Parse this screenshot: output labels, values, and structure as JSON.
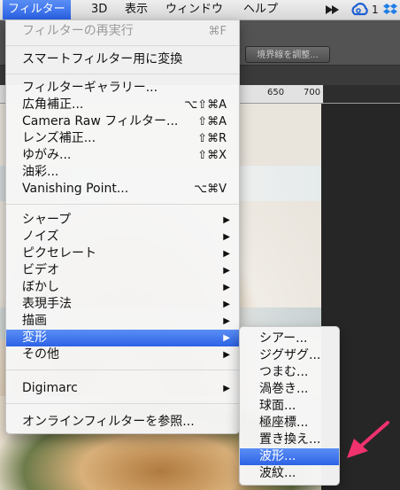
{
  "menubar": {
    "items": [
      {
        "label": "フィルター",
        "active": true
      },
      {
        "label": "3D"
      },
      {
        "label": "表示"
      },
      {
        "label": "ウィンドウ"
      },
      {
        "label": "ヘルプ"
      }
    ],
    "tray": {
      "count": "1",
      "icons": [
        "creative-cloud-sync-icon",
        "creative-cloud-icon",
        "dropbox-icon"
      ]
    }
  },
  "toolbar": {
    "refine_edge_label": "境界線を調整..."
  },
  "ruler": {
    "ticks": [
      "650",
      "700"
    ]
  },
  "filter_menu": {
    "last_filter": {
      "label": "フィルターの再実行",
      "shortcut": "⌘F"
    },
    "smart_filter": {
      "label": "スマートフィルター用に変換"
    },
    "gallery": {
      "label": "フィルターギャラリー..."
    },
    "wide_angle": {
      "label": "広角補正...",
      "shortcut": "⌥⇧⌘A"
    },
    "camera_raw": {
      "label": "Camera Raw フィルター...",
      "shortcut": "⇧⌘A"
    },
    "lens": {
      "label": "レンズ補正...",
      "shortcut": "⇧⌘R"
    },
    "liquify": {
      "label": "ゆがみ...",
      "shortcut": "⇧⌘X"
    },
    "oil": {
      "label": "油彩..."
    },
    "vanishing": {
      "label": "Vanishing Point...",
      "shortcut": "⌥⌘V"
    },
    "sharpen": {
      "label": "シャープ"
    },
    "noise": {
      "label": "ノイズ"
    },
    "pixelate": {
      "label": "ピクセレート"
    },
    "video": {
      "label": "ビデオ"
    },
    "blur": {
      "label": "ぼかし"
    },
    "stylize": {
      "label": "表現手法"
    },
    "render": {
      "label": "描画"
    },
    "distort": {
      "label": "変形"
    },
    "other": {
      "label": "その他"
    },
    "digimarc": {
      "label": "Digimarc"
    },
    "browse": {
      "label": "オンラインフィルターを参照..."
    }
  },
  "distort_submenu": {
    "items": [
      "シアー...",
      "ジグザグ...",
      "つまむ...",
      "渦巻き...",
      "球面...",
      "極座標...",
      "置き換え...",
      "波形...",
      "波紋..."
    ],
    "highlighted_index": 7
  },
  "colors": {
    "highlight": "#2d63e6",
    "pointer": "#f0326f"
  }
}
